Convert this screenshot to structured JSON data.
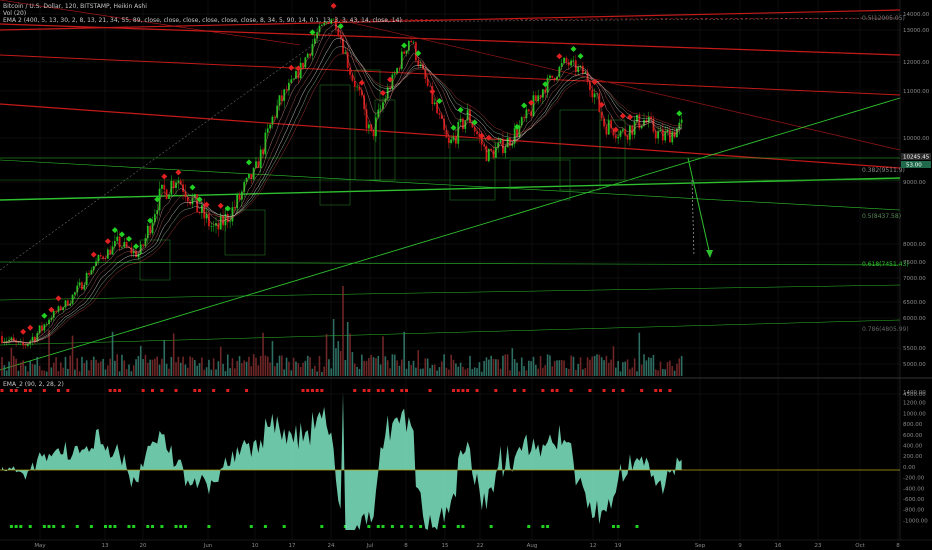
{
  "header": {
    "title": "Bitcoin / U.S. Dollar, 120, BITSTAMP, Heikin Ashi",
    "line2": "Vol (20)",
    "line3": "EMA 2 (400, 5, 13, 30, 2, 8, 13, 21, 34, 55, 89, close, close, close, close, close, close, 8, 34, 5, 90, 14, 0.1, 13, 3, 3, 43, 14, close, 14)"
  },
  "oscillator": {
    "label": "EMA_2 (90, 2, 28, 2)",
    "ticks": [
      "1400.00",
      "1200.00",
      "1000.00",
      "800.00",
      "600.00",
      "400.00",
      "200.00",
      "0.00",
      "-200.00",
      "-400.00",
      "-600.00",
      "-800.00",
      "-1000.00"
    ],
    "color_pos": "#7fe8c4",
    "color_neg": "#2fa8a0"
  },
  "chart_data": {
    "type": "candlestick",
    "symbol": "Bitcoin / U.S. Dollar",
    "interval": "120",
    "exchange": "BITSTAMP",
    "style": "Heikin Ashi",
    "price_ticks": [
      "14000.00",
      "13000.00",
      "12000.00",
      "11000.00",
      "10000.00",
      "9000.00",
      "8000.00",
      "7500.00",
      "7000.00",
      "6500.00",
      "6000.00",
      "5500.00",
      "5000.00",
      "4500.00"
    ],
    "x_ticks": [
      "May",
      "13",
      "20",
      "Jun",
      "10",
      "17",
      "24",
      "Jul",
      "8",
      "15",
      "22",
      "Aug",
      "12",
      "19",
      "Sep",
      "9",
      "16",
      "23",
      "Oct",
      "8"
    ],
    "current_price": "10245.45",
    "price_tag_2": "53.00",
    "price_path": [
      5700,
      5500,
      5800,
      6300,
      6800,
      7600,
      8000,
      7700,
      8700,
      9100,
      8600,
      8200,
      8600,
      9200,
      10500,
      11300,
      12600,
      13800,
      11500,
      10000,
      11200,
      12800,
      11000,
      9800,
      10500,
      9600,
      9900,
      10400,
      11200,
      12000,
      11600,
      10300,
      10100,
      10400,
      10000,
      10245
    ],
    "fib_levels": [
      {
        "label": "0.5(12905.05)",
        "price": 12905
      },
      {
        "label": "0.382(9511.9)",
        "price": 9511
      },
      {
        "label": "0.5(8437.58)",
        "price": 8437
      },
      {
        "label": "0.618(7451.43)",
        "price": 7451
      },
      {
        "label": "0.786(4805.99)",
        "price": 4805
      }
    ]
  },
  "colors": {
    "background": "#000000",
    "up": "#22c022",
    "down": "#d01818",
    "green_line": "#2ec02e",
    "red_line": "#c41a1a",
    "grid": "#1a1a1a"
  }
}
